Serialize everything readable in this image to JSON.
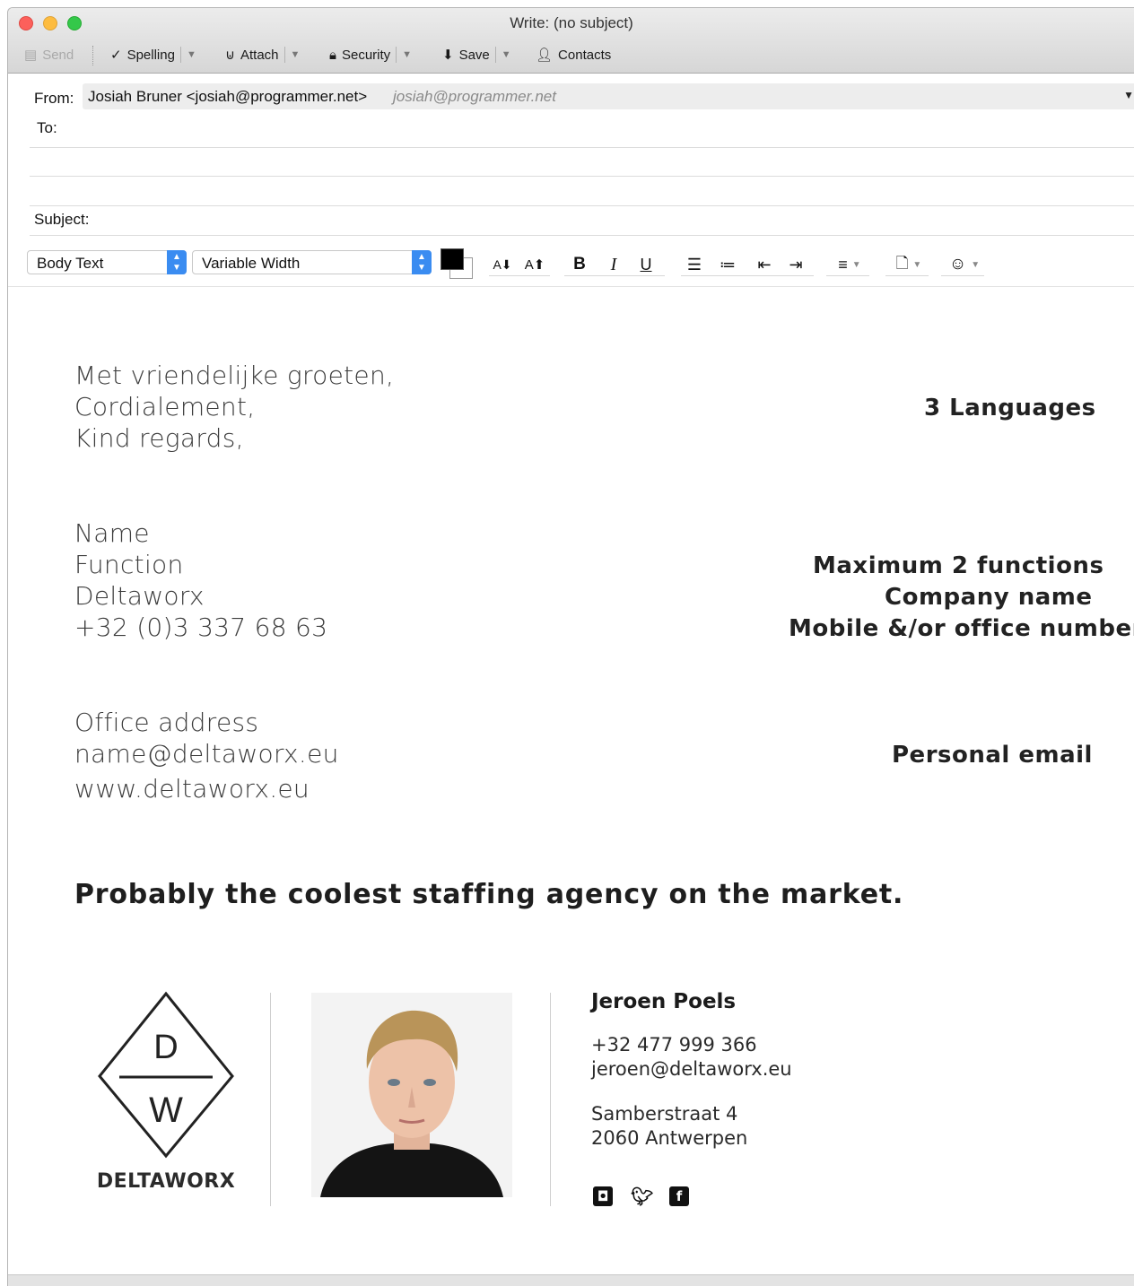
{
  "window": {
    "title": "Write: (no subject)"
  },
  "toolbar": {
    "send": "Send",
    "spelling": "Spelling",
    "attach": "Attach",
    "security": "Security",
    "save": "Save",
    "contacts": "Contacts"
  },
  "headers": {
    "from_label": "From:",
    "from_name": "Josiah Bruner <josiah@programmer.net>",
    "from_email": "josiah@programmer.net",
    "to_label": "To:",
    "subject_label": "Subject:"
  },
  "format": {
    "paragraph_style": "Body Text",
    "font": "Variable Width",
    "text_color": "#000000",
    "background_color": "#ffffff",
    "bold": "B",
    "italic": "I",
    "underline": "U"
  },
  "signature": {
    "greetings": [
      "Met vriendelijke groeten,",
      "Cordialement,",
      "Kind regards,"
    ],
    "details": [
      "Name",
      "Function",
      "Deltaworx",
      "+32 (0)3 337 68 63"
    ],
    "contact": [
      "Office address",
      "name@deltaworx.eu",
      "www.deltaworx.eu"
    ],
    "slogan": "Probably the coolest staffing agency on the market."
  },
  "notes": {
    "languages": "3 Languages",
    "functions": "Maximum 2 functions",
    "company": "Company name",
    "number": "Mobile &/or office number",
    "email": "Personal email"
  },
  "card": {
    "logo_top": "D",
    "logo_bottom": "W",
    "logo_word": "DELTAWORX",
    "name": "Jeroen Poels",
    "phone": "+32 477 999 366",
    "email": "jeroen@deltaworx.eu",
    "street": "Samberstraat 4",
    "city": "2060 Antwerpen",
    "social_icons": [
      "instagram-icon",
      "twitter-icon",
      "facebook-icon"
    ]
  }
}
